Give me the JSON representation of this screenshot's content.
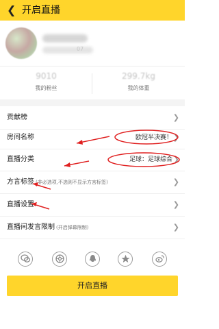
{
  "header": {
    "back_icon": "chevron-left-icon",
    "title": "开启直播",
    "bg_color": "#ffd52b"
  },
  "profile": {
    "id_fragment": "07"
  },
  "stats": [
    {
      "value": "9010",
      "label": "我的粉丝"
    },
    {
      "value": "299.7kg",
      "label": "我的体重"
    }
  ],
  "menu": [
    {
      "label": "贡献榜",
      "hint": "",
      "value": ""
    },
    {
      "label": "房间名称",
      "hint": "",
      "value": "欧冠半决赛！"
    },
    {
      "label": "直播分类",
      "hint": "",
      "value": "足球：足球综合"
    },
    {
      "label": "方言标签",
      "hint": "(非必选项,不选则不显示方言标签)",
      "value": ""
    },
    {
      "label": "直播设置",
      "hint": "",
      "value": ""
    },
    {
      "label": "直播间发言限制",
      "hint": "(开启弹幕限制)",
      "value": ""
    }
  ],
  "share_icons": [
    "wechat-icon",
    "moments-icon",
    "qq-icon",
    "qzone-star-icon",
    "weibo-icon"
  ],
  "start_button": {
    "label": "开启直播"
  },
  "annotation_color": "#e02020"
}
